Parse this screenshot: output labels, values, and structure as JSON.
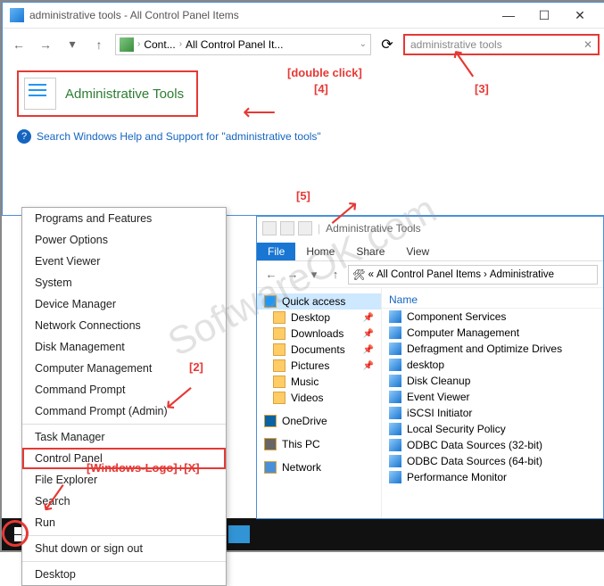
{
  "cp_window": {
    "title": "administrative tools - All Control Panel Items",
    "breadcrumb": {
      "part1": "Cont...",
      "part2": "All Control Panel It..."
    },
    "search_value": "administrative tools",
    "result_label": "Administrative Tools",
    "help_text": "Search Windows Help and Support for \"administrative tools\""
  },
  "annotations": {
    "a4": "[4]",
    "a4_hint": "[double click]",
    "a3": "[3]",
    "a5": "[5]",
    "a2": "[2]",
    "winx": "[Windows-Logo]+[X]"
  },
  "watermark": "SoftwareOK.com",
  "winx_menu": [
    "Programs and Features",
    "Power Options",
    "Event Viewer",
    "System",
    "Device Manager",
    "Network Connections",
    "Disk Management",
    "Computer Management",
    "Command Prompt",
    "Command Prompt (Admin)",
    "Task Manager",
    "Control Panel",
    "File Explorer",
    "Search",
    "Run",
    "Shut down or sign out",
    "Desktop"
  ],
  "explorer": {
    "title": "Administrative Tools",
    "tabs": {
      "file": "File",
      "home": "Home",
      "share": "Share",
      "view": "View"
    },
    "breadcrumb": {
      "p1": "All Control Panel Items",
      "p2": "Administrative"
    },
    "sidebar": {
      "quick": "Quick access",
      "items": [
        "Desktop",
        "Downloads",
        "Documents",
        "Pictures",
        "Music",
        "Videos"
      ],
      "onedrive": "OneDrive",
      "thispc": "This PC",
      "network": "Network"
    },
    "column": "Name",
    "files": [
      "Component Services",
      "Computer Management",
      "Defragment and Optimize Drives",
      "desktop",
      "Disk Cleanup",
      "Event Viewer",
      "iSCSI Initiator",
      "Local Security Policy",
      "ODBC Data Sources (32-bit)",
      "ODBC Data Sources (64-bit)",
      "Performance Monitor"
    ]
  }
}
